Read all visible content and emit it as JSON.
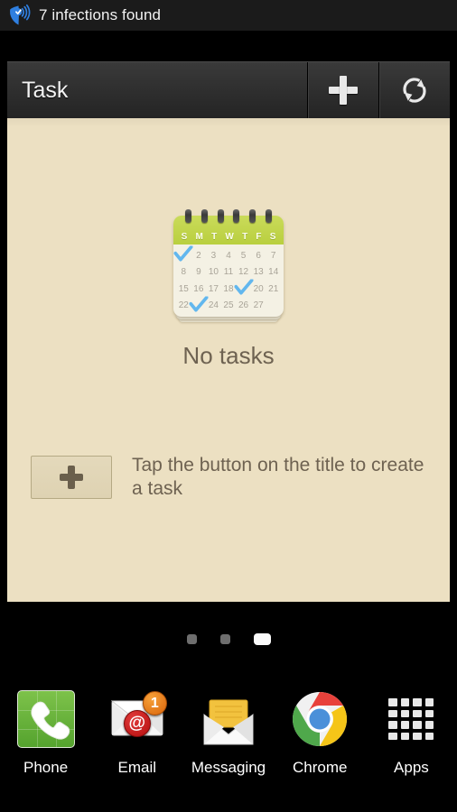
{
  "status_bar": {
    "icon": "antivirus-shield-icon",
    "text": "7 infections found",
    "icon_color": "#2f7fe0",
    "background": "#1b1b1b"
  },
  "app_bar": {
    "title": "Task",
    "actions": [
      {
        "name": "add-task-button",
        "icon": "plus-icon"
      },
      {
        "name": "refresh-button",
        "icon": "refresh-icon"
      }
    ]
  },
  "content": {
    "background": "#ece0c2",
    "illustration": {
      "name": "calendar-icon",
      "header_color": "#bfd447",
      "weekday_labels": [
        "S",
        "M",
        "T",
        "W",
        "T",
        "F",
        "S"
      ],
      "ring_count": 6,
      "check_color": "#62b7ee",
      "days": [
        {
          "label": "1",
          "checked": true
        },
        {
          "label": "2",
          "checked": false
        },
        {
          "label": "3",
          "checked": false
        },
        {
          "label": "4",
          "checked": false
        },
        {
          "label": "5",
          "checked": false
        },
        {
          "label": "6",
          "checked": false
        },
        {
          "label": "7",
          "checked": false
        },
        {
          "label": "8",
          "checked": false
        },
        {
          "label": "9",
          "checked": false
        },
        {
          "label": "10",
          "checked": false
        },
        {
          "label": "11",
          "checked": false
        },
        {
          "label": "12",
          "checked": false
        },
        {
          "label": "13",
          "checked": false
        },
        {
          "label": "14",
          "checked": false
        },
        {
          "label": "15",
          "checked": false
        },
        {
          "label": "16",
          "checked": false
        },
        {
          "label": "17",
          "checked": false
        },
        {
          "label": "18",
          "checked": false
        },
        {
          "label": "19",
          "checked": true
        },
        {
          "label": "20",
          "checked": false
        },
        {
          "label": "21",
          "checked": false
        },
        {
          "label": "22",
          "checked": false
        },
        {
          "label": "23",
          "checked": true
        },
        {
          "label": "24",
          "checked": false
        },
        {
          "label": "25",
          "checked": false
        },
        {
          "label": "26",
          "checked": false
        },
        {
          "label": "27",
          "checked": false
        }
      ]
    },
    "empty_state_title": "No tasks",
    "hint": {
      "button_icon": "plus-icon",
      "text": "Tap the button on the title to create a task"
    }
  },
  "page_indicator": {
    "total": 3,
    "active_index": 2
  },
  "dock": {
    "items": [
      {
        "label": "Phone",
        "icon": "phone-icon"
      },
      {
        "label": "Email",
        "icon": "email-icon",
        "badge": "1"
      },
      {
        "label": "Messaging",
        "icon": "messaging-icon"
      },
      {
        "label": "Chrome",
        "icon": "chrome-icon"
      },
      {
        "label": "Apps",
        "icon": "apps-grid-icon"
      }
    ]
  }
}
